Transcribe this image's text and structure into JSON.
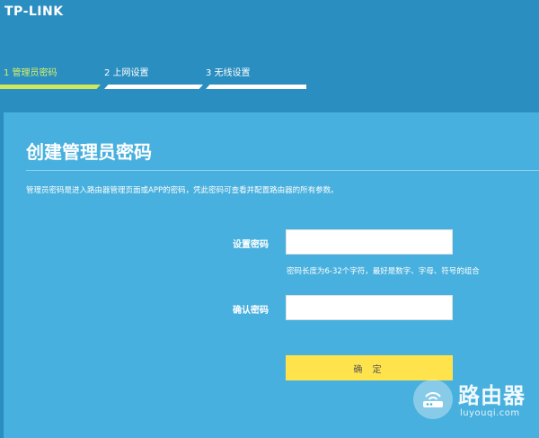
{
  "brand": {
    "logo_text": "TP-LINK"
  },
  "steps": [
    {
      "label": "1 管理员密码",
      "state": "active"
    },
    {
      "label": "2 上网设置",
      "state": "pending"
    },
    {
      "label": "3 无线设置",
      "state": "pending"
    }
  ],
  "form": {
    "title": "创建管理员密码",
    "description": "管理员密码是进入路由器管理页面或APP的密码，凭此密码可查看并配置路由器的所有参数。",
    "password_label": "设置密码",
    "password_value": "",
    "password_hint": "密码长度为6-32个字符，最好是数字、字母、符号的组合",
    "confirm_label": "确认密码",
    "confirm_value": "",
    "submit_label": "确 定"
  },
  "watermark": {
    "title": "路由器",
    "subtitle": "luyouqi.com"
  },
  "colors": {
    "header_bg": "#2a8ec0",
    "panel_bg": "#48b0de",
    "active_step": "#cfe85a",
    "submit_bg": "#ffe34d"
  },
  "icons": {
    "watermark_icon": "router-icon"
  }
}
